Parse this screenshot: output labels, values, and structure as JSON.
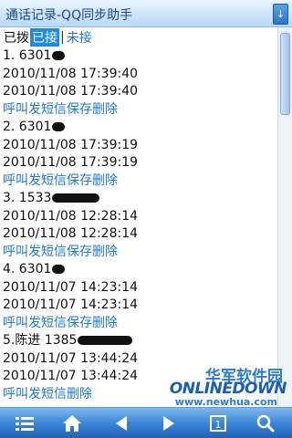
{
  "window": {
    "title": "通话记录-QQ同步助手",
    "scroll_down_label": "↓"
  },
  "tabs": [
    {
      "label": "已拨",
      "active": false
    },
    {
      "label": "已接",
      "active": true
    },
    {
      "label": "未接",
      "active": false
    }
  ],
  "entries": [
    {
      "number": "1. 6301",
      "time1": "2010/11/08 17:39:40",
      "time2": "2010/11/08 17:39:40",
      "actions": [
        "呼叫",
        "发短信",
        "保存",
        "删除"
      ]
    },
    {
      "number": "2. 6301",
      "time1": "2010/11/08 17:39:19",
      "time2": "2010/11/08 17:39:19",
      "actions": [
        "呼叫",
        "发短信",
        "保存",
        "删除"
      ]
    },
    {
      "number": "3. 1533",
      "time1": "2010/11/08 12:28:14",
      "time2": "2010/11/08 12:28:14",
      "actions": [
        "呼叫",
        "发短信",
        "保存",
        "删除"
      ]
    },
    {
      "number": "4. 6301",
      "time1": "2010/11/07 14:23:14",
      "time2": "2010/11/07 14:23:14",
      "actions": [
        "呼叫",
        "发短信",
        "保存",
        "删除"
      ]
    },
    {
      "number": "5.陈进 1385",
      "time1": "2010/11/07 13:44:24",
      "time2": "2010/11/07 13:44:24",
      "actions": [
        "呼叫",
        "发短信",
        "删除"
      ]
    }
  ],
  "watermark": {
    "cn": "华军软件园",
    "en": "ONLINEDOWN",
    "url": "www.newhua.com"
  },
  "toolbar": {
    "buttons": [
      {
        "icon": "menu-icon"
      },
      {
        "icon": "home-icon"
      },
      {
        "icon": "arrow-left-icon"
      },
      {
        "icon": "arrow-right-icon"
      },
      {
        "icon": "page-icon",
        "label": "1"
      },
      {
        "icon": "search-icon"
      }
    ]
  },
  "colors": {
    "accent": "#1e8be0",
    "link": "#2079c8",
    "toolbar": "#3d86d6"
  }
}
